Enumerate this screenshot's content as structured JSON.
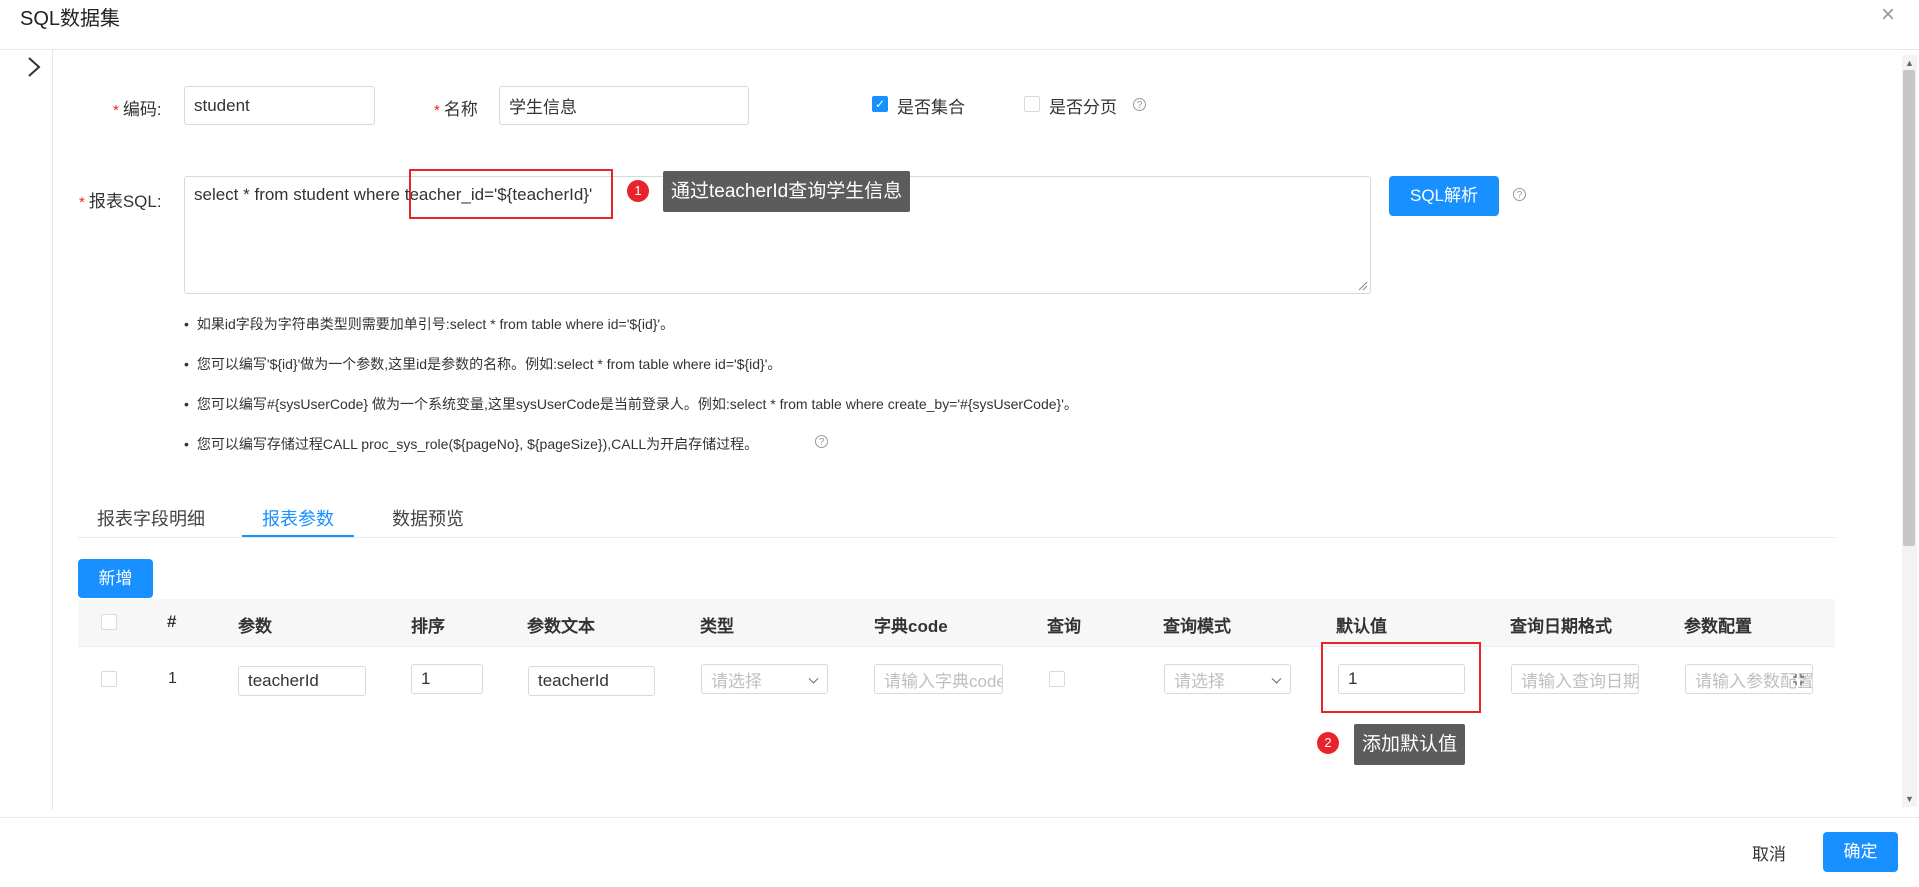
{
  "dialog": {
    "title": "SQL数据集",
    "close_icon": "×",
    "chevron": "›"
  },
  "form": {
    "code_label": "编码:",
    "code_value": "student",
    "name_label": "名称",
    "name_value": "学生信息",
    "is_collection_label": "是否集合",
    "is_collection_checked": true,
    "is_paged_label": "是否分页",
    "is_paged_checked": false,
    "sql_label": "报表SQL:",
    "sql_prefix": "select * from student where ",
    "sql_highlight": "teacher_id='${teacherId}'",
    "sql_parse_button": "SQL解析",
    "help_symbol": "?"
  },
  "annotations": [
    {
      "number": "1",
      "text": "通过teacherId查询学生信息"
    },
    {
      "number": "2",
      "text": "添加默认值"
    }
  ],
  "notes": [
    "如果id字段为字符串类型则需要加单引号:select * from table where id='${id}'。",
    "您可以编写'${id}'做为一个参数,这里id是参数的名称。例如:select * from table where id='${id}'。",
    "您可以编写#{sysUserCode} 做为一个系统变量,这里sysUserCode是当前登录人。例如:select * from table where create_by='#{sysUserCode}'。",
    "您可以编写存储过程CALL proc_sys_role(${pageNo}, ${pageSize}),CALL为开启存储过程。"
  ],
  "tabs": [
    {
      "label": "报表字段明细",
      "active": false
    },
    {
      "label": "报表参数",
      "active": true
    },
    {
      "label": "数据预览",
      "active": false
    }
  ],
  "add_button": "新增",
  "table": {
    "headers": [
      "#",
      "参数",
      "排序",
      "参数文本",
      "类型",
      "字典code",
      "查询",
      "查询模式",
      "默认值",
      "查询日期格式",
      "参数配置"
    ],
    "row": {
      "index": "1",
      "param": "teacherId",
      "order": "1",
      "param_text": "teacherId",
      "type_placeholder": "请选择",
      "dict_placeholder": "请输入字典code",
      "query_mode_placeholder": "请选择",
      "default_value": "1",
      "date_format_placeholder": "请输入查询日期格式",
      "param_config_placeholder": "请输入参数配置"
    }
  },
  "footer": {
    "cancel": "取消",
    "confirm": "确定"
  },
  "colors": {
    "primary": "#1890ff",
    "required": "#f5222d",
    "annotation": "#e8242b",
    "tooltip": "#5c5c5c"
  }
}
